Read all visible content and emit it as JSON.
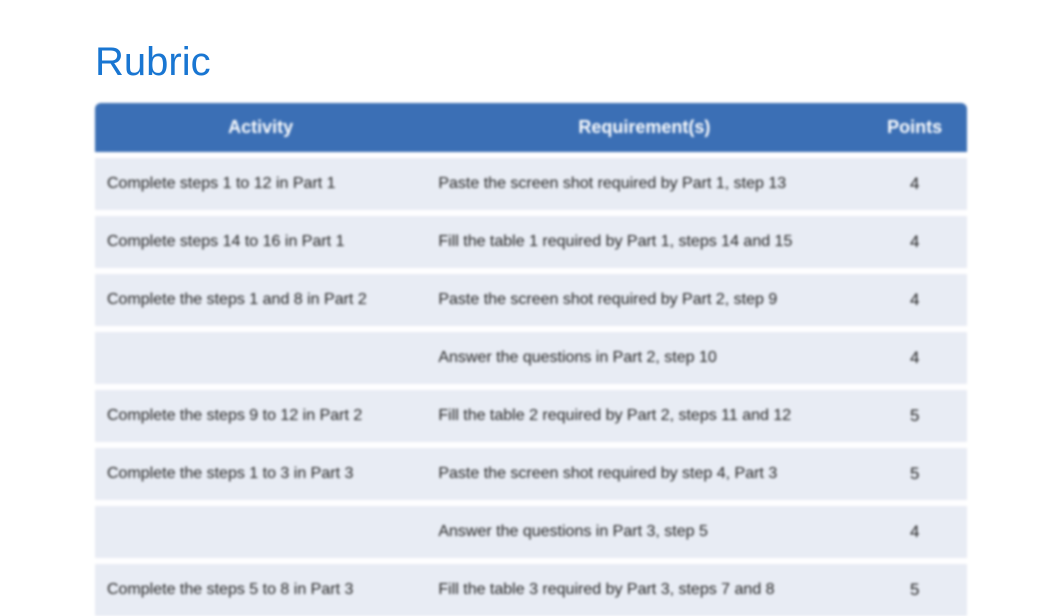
{
  "title": "Rubric",
  "headers": {
    "activity": "Activity",
    "requirement": "Requirement(s)",
    "points": "Points"
  },
  "rows": [
    {
      "activity": "Complete steps 1 to 12 in Part 1",
      "requirement": "Paste the screen shot required by Part 1, step 13",
      "points": "4"
    },
    {
      "activity": "Complete steps 14 to 16 in Part 1",
      "requirement": "Fill the table 1 required by Part 1, steps 14 and 15",
      "points": "4"
    },
    {
      "activity": "Complete the steps 1 and 8 in Part 2",
      "requirement": "Paste the screen shot required by Part 2, step 9",
      "points": "4"
    },
    {
      "activity": "",
      "requirement": "Answer the questions in Part 2, step 10",
      "points": "4"
    },
    {
      "activity": "Complete the steps 9 to 12 in Part 2",
      "requirement": "Fill the table 2 required by Part 2, steps 11 and 12",
      "points": "5"
    },
    {
      "activity": "Complete the steps 1 to 3 in Part 3",
      "requirement": "Paste the screen shot required by step 4, Part 3",
      "points": "5"
    },
    {
      "activity": "",
      "requirement": "Answer the questions in Part 3, step 5",
      "points": "4"
    },
    {
      "activity": "Complete the steps 5 to 8 in Part 3",
      "requirement": "Fill the table 3 required by Part 3, steps 7 and 8",
      "points": "5"
    }
  ]
}
